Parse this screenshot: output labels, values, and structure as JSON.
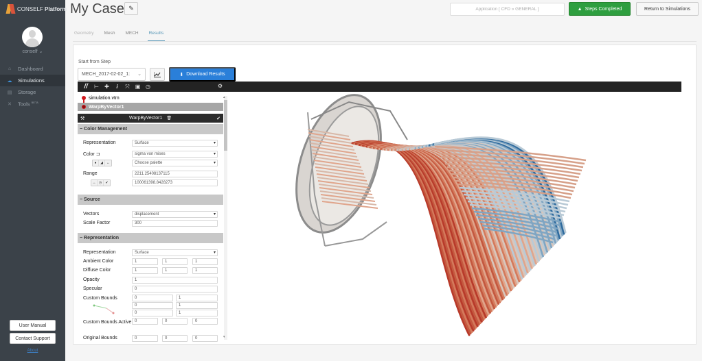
{
  "sidebar": {
    "brand": "CONSELF",
    "brand_bold": "Platform",
    "username": "conself",
    "items": [
      {
        "label": "Dashboard",
        "icon": "home-icon",
        "glyph": "⌂",
        "active": false
      },
      {
        "label": "Simulations",
        "icon": "cloud-icon",
        "glyph": "☁",
        "active": true
      },
      {
        "label": "Storage",
        "icon": "storage-icon",
        "glyph": "▤",
        "active": false
      },
      {
        "label": "Tools",
        "icon": "tools-icon",
        "glyph": "✕",
        "active": false,
        "badge": "BETA"
      }
    ],
    "user_manual": "User Manual",
    "contact_support": "Contact Support",
    "about": "About"
  },
  "header": {
    "title": "My Case",
    "application": "Application [ CFD » GENERAL ]",
    "steps_completed": "Steps Completed",
    "return": "Return to Simulations"
  },
  "tabs": [
    {
      "label": "Geometry",
      "state": "muted"
    },
    {
      "label": "Mesh",
      "state": "normal"
    },
    {
      "label": "MECH",
      "state": "normal"
    },
    {
      "label": "Results",
      "state": "active"
    }
  ],
  "results": {
    "start_from_step_label": "Start from Step",
    "step_value": "MECH_2017-02-02_1:",
    "download": "Download Results"
  },
  "pipeline": {
    "items": [
      "simulation.vtm",
      "WarpByVector1"
    ],
    "panel_title": "WarpByVector1",
    "color_management": {
      "title": "Color Management",
      "representation_label": "Representation",
      "representation": "Surface",
      "color_label": "Color",
      "color": "sigma von mises",
      "palette": "Choose palette",
      "range_label": "Range",
      "range_min": "2211.25408137115",
      "range_max": "100061398.8428273"
    },
    "source": {
      "title": "Source",
      "vectors_label": "Vectors",
      "vectors": "displacement",
      "scale_factor_label": "Scale Factor",
      "scale_factor": "300"
    },
    "representation": {
      "title": "Representation",
      "representation_label": "Representation",
      "representation": "Surface",
      "ambient_label": "Ambient Color",
      "ambient": [
        "1",
        "1",
        "1"
      ],
      "diffuse_label": "Diffuse Color",
      "diffuse": [
        "1",
        "1",
        "1"
      ],
      "opacity_label": "Opacity",
      "opacity": "1",
      "specular_label": "Specular",
      "specular": "0",
      "custom_bounds_label": "Custom Bounds",
      "custom_bounds": [
        [
          "0",
          "1"
        ],
        [
          "0",
          "1"
        ],
        [
          "0",
          "1"
        ]
      ],
      "custom_bounds_active_label": "Custom Bounds Active",
      "custom_bounds_active": [
        "0",
        "0",
        "0"
      ],
      "original_bounds_label": "Original Bounds",
      "original_bounds": [
        "0",
        "0",
        "0"
      ]
    }
  },
  "colors": {
    "sidebar_bg": "#3b4249",
    "accent_blue": "#2a7fd9",
    "success_green": "#2e9e3f",
    "pipeline_red": "#d0191e",
    "stress_high": "#b83a2a",
    "stress_low": "#2f6b9e"
  }
}
